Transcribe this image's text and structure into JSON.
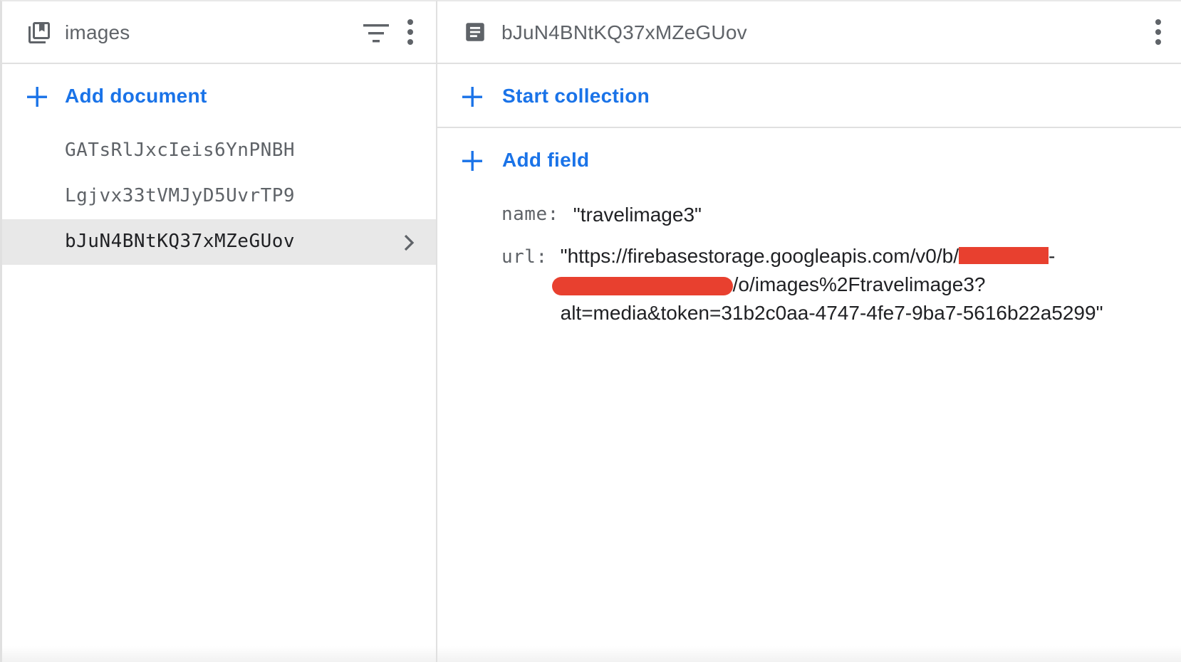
{
  "collection_panel": {
    "title": "images",
    "add_label": "Add document",
    "documents": [
      {
        "id": "GATsRlJxcIeis6YnPNBH",
        "selected": false
      },
      {
        "id": "Lgjvx33tVMJyD5UvrTP9",
        "selected": false
      },
      {
        "id": "bJuN4BNtKQ37xMZeGUov",
        "selected": true
      }
    ]
  },
  "document_panel": {
    "title": "bJuN4BNtKQ37xMZeGUov",
    "start_collection_label": "Start collection",
    "add_field_label": "Add field",
    "fields": {
      "name": {
        "key": "name:",
        "value": "\"travelimage3\""
      },
      "url": {
        "key": "url:",
        "value_part1": "\"https://firebasestorage.googleapis.com/v0/b/",
        "value_part2": "-",
        "value_part3": "/o/images%2Ftravelimage3?",
        "value_part4": "alt=media&token=31b2c0aa-4747-4fe7-9ba7-5616b22a5299\""
      }
    }
  },
  "colors": {
    "accent": "#1a73e8",
    "redaction": "#e8402f",
    "selected_row": "#e8e8e8"
  },
  "icons": {
    "collection": "collection-icon",
    "filter": "filter-icon",
    "more": "more-vert-icon",
    "document": "document-icon",
    "add": "plus-icon",
    "chevron": "chevron-right-icon"
  }
}
